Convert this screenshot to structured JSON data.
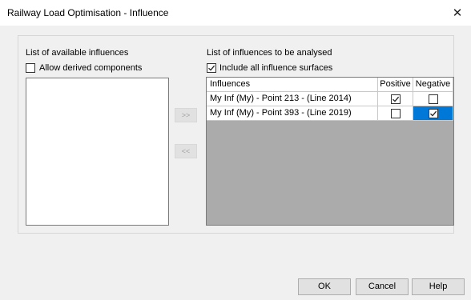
{
  "window": {
    "title": "Railway Load Optimisation - Influence",
    "close_glyph": "✕"
  },
  "left_panel": {
    "heading": "List of available influences",
    "derived_checkbox": {
      "label": "Allow derived components",
      "checked": false
    },
    "items": []
  },
  "move_buttons": {
    "add": ">>",
    "remove": "<<"
  },
  "right_panel": {
    "heading": "List of influences to be analysed",
    "include_checkbox": {
      "label": "Include all influence surfaces",
      "checked": true
    },
    "columns": [
      "Influences",
      "Positive",
      "Negative"
    ],
    "rows": [
      {
        "name": "My Inf (My) - Point 213 - (Line 2014)",
        "positive": true,
        "negative": false
      },
      {
        "name": "My Inf (My) - Point 393 - (Line 2019)",
        "positive": false,
        "negative": true
      }
    ]
  },
  "buttons": {
    "ok": "OK",
    "cancel": "Cancel",
    "help": "Help"
  },
  "colors": {
    "selection": "#0078d7",
    "grid_background": "#ababab"
  }
}
